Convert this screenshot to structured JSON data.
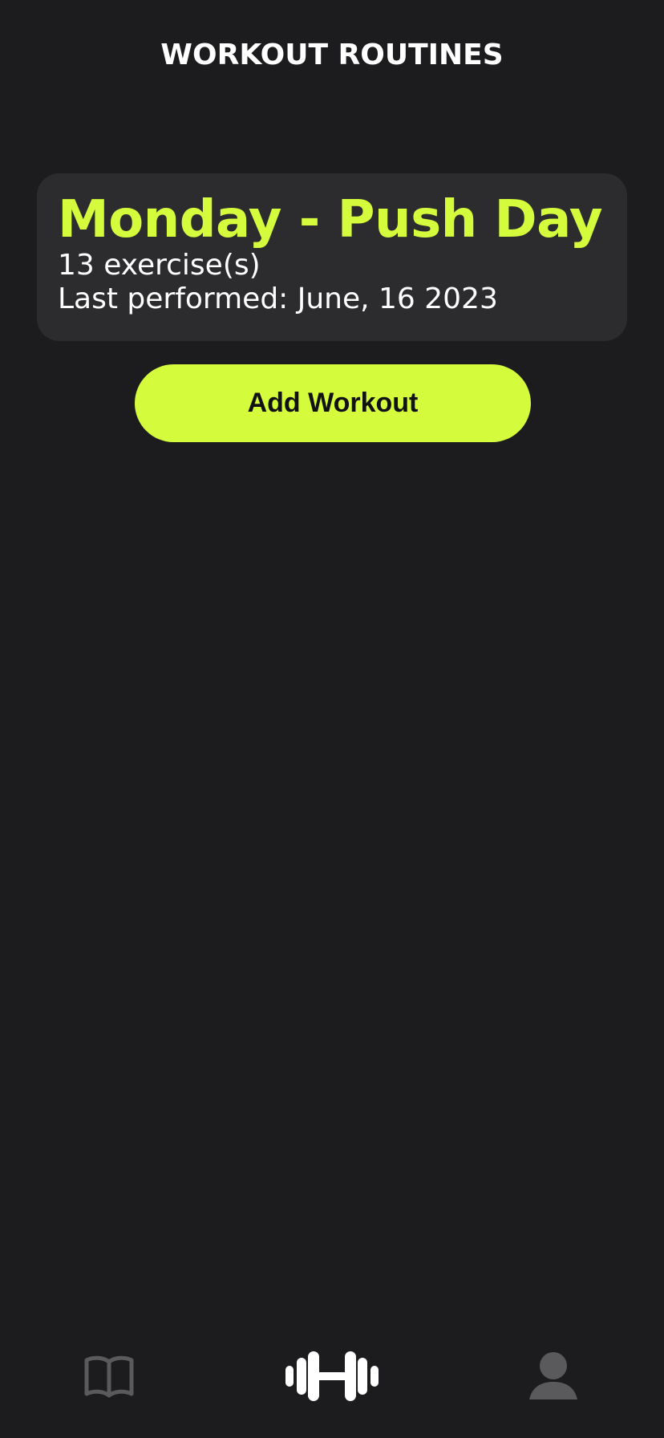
{
  "header": {
    "title": "WORKOUT ROUTINES"
  },
  "routines": [
    {
      "name": "Monday - Push Day",
      "exercise_count": "13 exercise(s)",
      "last_performed": "Last performed: June, 16 2023"
    }
  ],
  "actions": {
    "add_workout_label": "Add Workout"
  },
  "tab_bar": {
    "items": [
      {
        "icon": "book-icon",
        "active": false
      },
      {
        "icon": "dumbbell-icon",
        "active": true
      },
      {
        "icon": "profile-icon",
        "active": false
      }
    ]
  },
  "colors": {
    "background": "#1c1c1e",
    "card": "#2c2c2e",
    "accent": "#d4fb3c",
    "inactive_icon": "#5a5a5c",
    "active_icon": "#ffffff"
  }
}
